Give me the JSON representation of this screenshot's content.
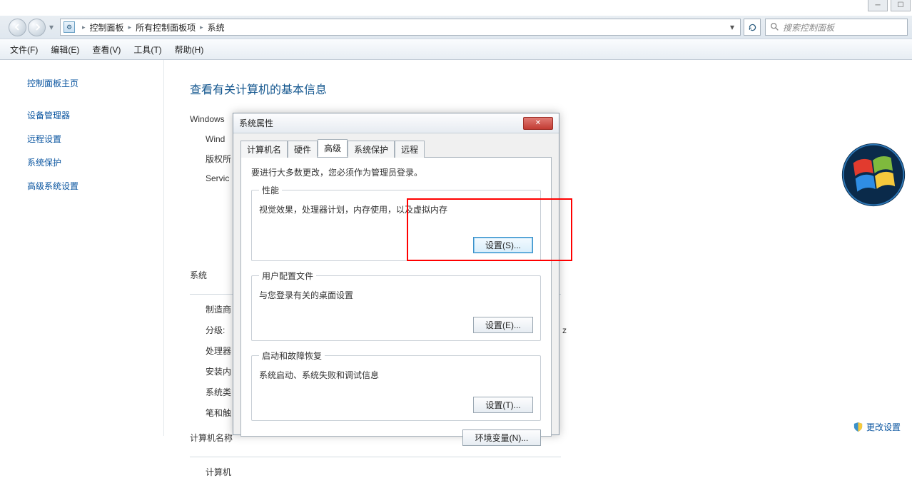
{
  "nav": {
    "crumb1": "控制面板",
    "crumb2": "所有控制面板项",
    "crumb3": "系统",
    "search_placeholder": "搜索控制面板"
  },
  "menu": {
    "file": "文件(F)",
    "edit": "编辑(E)",
    "view": "查看(V)",
    "tools": "工具(T)",
    "help": "帮助(H)"
  },
  "sidebar": {
    "home": "控制面板主页",
    "devmgr": "设备管理器",
    "remote": "远程设置",
    "protect": "系统保护",
    "advanced": "高级系统设置"
  },
  "main": {
    "heading": "查看有关计算机的基本信息",
    "winEdition": "Windows",
    "winLine": "Wind",
    "copyright": "版权所",
    "servicepack": "Servic",
    "system_hdr": "系统",
    "maker": "制造商",
    "rating": "分级:",
    "processor": "处理器",
    "ram": "安装内",
    "systype": "系统类",
    "pen": "笔和触",
    "cname_hdr": "计算机名称",
    "cname": "计算机",
    "zsuffix": "z"
  },
  "dialog": {
    "title": "系统属性",
    "tabs": {
      "cname": "计算机名",
      "hw": "硬件",
      "adv": "高级",
      "protect": "系统保护",
      "remote": "远程"
    },
    "adminNote": "要进行大多数更改，您必须作为管理员登录。",
    "perf": {
      "legend": "性能",
      "desc": "视觉效果，处理器计划，内存使用，以及虚拟内存",
      "btn": "设置(S)..."
    },
    "profile": {
      "legend": "用户配置文件",
      "desc": "与您登录有关的桌面设置",
      "btn": "设置(E)..."
    },
    "startup": {
      "legend": "启动和故障恢复",
      "desc": "系统启动、系统失败和调试信息",
      "btn": "设置(T)..."
    },
    "envBtn": "环境变量(N)..."
  },
  "footer": {
    "more": "更改设置"
  }
}
